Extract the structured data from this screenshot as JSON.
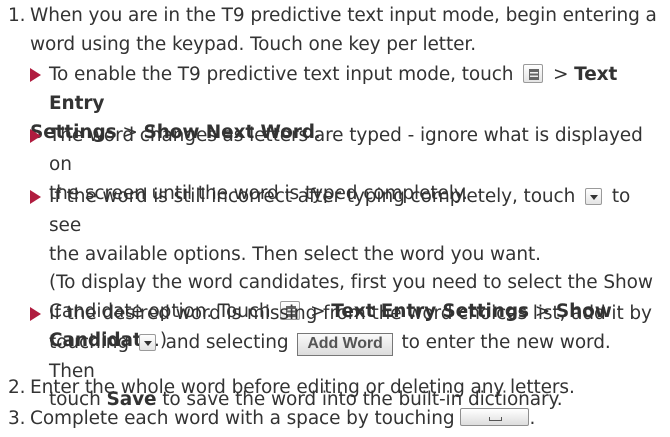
{
  "steps": [
    {
      "num": "1.",
      "line1": "When you are in the T9 predictive text input mode, begin entering a",
      "line2": "word using the keypad. Touch one key per letter.",
      "bullets": [
        {
          "a1": "To enable the T9 predictive text input mode, touch",
          "a2": ">",
          "b1": "Text Entry",
          "b2": "Settings",
          "b3": ">",
          "b4": "Show Next Word",
          "b5": "."
        },
        {
          "l1": "The word changes as letters are typed - ignore what is displayed on",
          "l2": "the screen until the word is typed completely."
        },
        {
          "l1a": "If the word is still incorrect after typing completely, touch",
          "l1b": "to see",
          "l2": "the available options. Then select the word you want.",
          "l3": "(To display the word candidates, first you need to select the Show",
          "l4a": "Candidate option. Touch",
          "l4b": ">",
          "l4c": "Text Entry Settings",
          "l4d": ">",
          "l4e": "Show Candidate",
          "l4f": ".)"
        },
        {
          "l1": "If the desired word is missing from the word choices list, add it by",
          "l2a": "touching",
          "l2b": "and selecting",
          "l2c": "Add Word",
          "l2d": "to enter the new word. Then",
          "l3a": "touch",
          "l3b": "Save",
          "l3c": "to save the word into the built-in dictionary."
        }
      ]
    },
    {
      "num": "2.",
      "text": "Enter the whole word before editing or deleting any letters."
    },
    {
      "num": "3.",
      "text": "Complete each word with a space by touching"
    }
  ],
  "icons": {
    "menu": "menu-icon",
    "dropdown": "dropdown-arrow-icon",
    "space": "space-key-icon"
  },
  "colors": {
    "bullet_arrow": "#b01c3f",
    "text": "#333333"
  }
}
